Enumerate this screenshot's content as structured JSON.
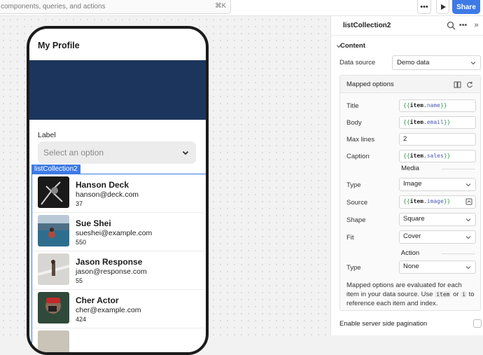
{
  "topbar": {
    "search_text": "components, queries, and actions",
    "shortcut": "⌘K",
    "more_icon": "more-icon",
    "run_icon": "play-icon",
    "share_label": "Share"
  },
  "phone": {
    "title": "My Profile",
    "banner_color": "#1c355c",
    "field_label": "Label",
    "select_placeholder": "Select an option",
    "component_tag": "listCollection2",
    "items": [
      {
        "title": "Hanson Deck",
        "body": "hanson@deck.com",
        "caption": "37"
      },
      {
        "title": "Sue Shei",
        "body": "sueshei@example.com",
        "caption": "550"
      },
      {
        "title": "Jason Response",
        "body": "jason@response.com",
        "caption": "55"
      },
      {
        "title": "Cher Actor",
        "body": "cher@example.com",
        "caption": "424"
      }
    ]
  },
  "panel": {
    "title": "listCollection2",
    "section": "Content",
    "data_source_label": "Data source",
    "data_source_value": "Demo data",
    "mapped_title": "Mapped options",
    "rows": {
      "title_label": "Title",
      "title_item": "item",
      "title_prop": "name",
      "body_label": "Body",
      "body_item": "item",
      "body_prop": "email",
      "maxlines_label": "Max lines",
      "maxlines_value": "2",
      "caption_label": "Caption",
      "caption_item": "item",
      "caption_prop": "sales"
    },
    "media_label": "Media",
    "media": {
      "type_label": "Type",
      "type_value": "Image",
      "source_label": "Source",
      "source_item": "item",
      "source_prop": "image",
      "shape_label": "Shape",
      "shape_value": "Square",
      "fit_label": "Fit",
      "fit_value": "Cover"
    },
    "action_label": "Action",
    "action": {
      "type_label": "Type",
      "type_value": "None"
    },
    "note": {
      "part1": "Mapped options are evaluated for each item in your data source. Use",
      "code1": "item",
      "part2": "or",
      "code2": "i",
      "part3": "to reference each item and index."
    },
    "pagination_label": "Enable server side pagination"
  },
  "colors": {
    "accent": "#3d7ae6",
    "banner": "#1c355c"
  }
}
